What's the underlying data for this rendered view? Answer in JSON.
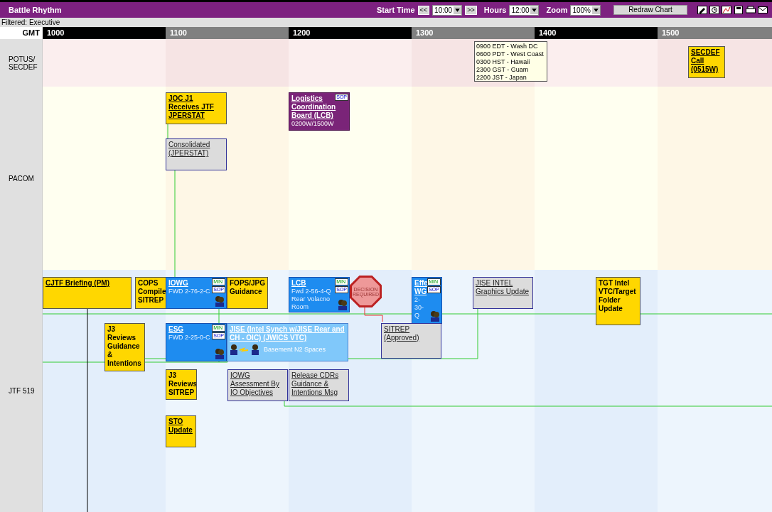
{
  "title_bar": {
    "title": "Battle Rhythm",
    "start_time_label": "Start Time",
    "prev_button": "<<",
    "start_time": "10:00",
    "next_button": ">>",
    "hours_label": "Hours",
    "hours": "12:00",
    "zoom_label": "Zoom",
    "zoom": "100%",
    "redraw_button": "Redraw Chart"
  },
  "filter": "Filtered: Executive",
  "timeline": {
    "zone": "GMT",
    "hours": [
      "1000",
      "1100",
      "1200",
      "1300",
      "1400",
      "1500"
    ]
  },
  "lanes": [
    {
      "label": "POTUS/ SECDEF",
      "kind": "pink"
    },
    {
      "label": "PACOM",
      "kind": "cream"
    },
    {
      "label": "JTF 519",
      "kind": "blue"
    }
  ],
  "events": [
    {
      "kind": "note",
      "lines": [
        "0900 EDT - Wash DC",
        "0600 PDT - West Coast",
        "0300 HST - Hawaii",
        "2300 GST - Guam",
        "2200 JST - Japan"
      ]
    },
    {
      "kind": "yellow",
      "title": "SECDEF Call (0515W)",
      "link": true
    },
    {
      "kind": "yellow",
      "title": "JOC J1 Receives JTF JPERSTAT",
      "link": true
    },
    {
      "kind": "grey",
      "title": "Consolidated (JPERSTAT)"
    },
    {
      "kind": "purple",
      "title": "Logistics Coordination Board (LCB)",
      "subtitle": "0200W/1500W",
      "badges": [
        "SOP"
      ]
    },
    {
      "kind": "yellow",
      "title": "CJTF Briefing (PM)",
      "link": true
    },
    {
      "kind": "yellow",
      "title": "COPS Compile SITREP",
      "link": false
    },
    {
      "kind": "blue",
      "title": "IOWG",
      "subtitle": "FWD 2-76-2-C",
      "badges": [
        "MIN",
        "SOP"
      ]
    },
    {
      "kind": "yellow",
      "title": "FOPS/JPG Guidance",
      "link": false
    },
    {
      "kind": "blue",
      "title": "LCB",
      "subtitle": "Fwd 2-56-4-Q Rear Volacno Room",
      "badges": [
        "MIN",
        "SOP"
      ]
    },
    {
      "kind": "decision",
      "title": "DECISION REQUIRED"
    },
    {
      "kind": "blue",
      "title": "Effe WG",
      "subtitle": "2-30- Q",
      "badges": [
        "MIN",
        "SOP"
      ]
    },
    {
      "kind": "grey",
      "title": "JISE INTEL Graphics Update"
    },
    {
      "kind": "yellow",
      "title": "TGT Intel VTC/Target Folder Update",
      "link": false
    },
    {
      "kind": "yellow",
      "title": "J3 Reviews Guidance & Intentions",
      "link": false
    },
    {
      "kind": "blue",
      "title": "ESG",
      "subtitle": "FWD 2-25-0-C",
      "badges": [
        "MIN",
        "SOP"
      ]
    },
    {
      "kind": "lightblue",
      "title": "JISE (Intel Synch w/JISE Rear and CH - OIC) (JWICS VTC)",
      "subtitle": "Basement N2 Spaces"
    },
    {
      "kind": "grey",
      "title": "SITREP (Approved)"
    },
    {
      "kind": "yellow",
      "title": "J3 Reviews SITREP",
      "link": false
    },
    {
      "kind": "grey",
      "title": "IOWG Assessment By IO Objectives"
    },
    {
      "kind": "grey",
      "title": "Release CDRs Guidance & Intentions Msg"
    },
    {
      "kind": "yellow",
      "title": "STO Update",
      "link": true
    }
  ]
}
